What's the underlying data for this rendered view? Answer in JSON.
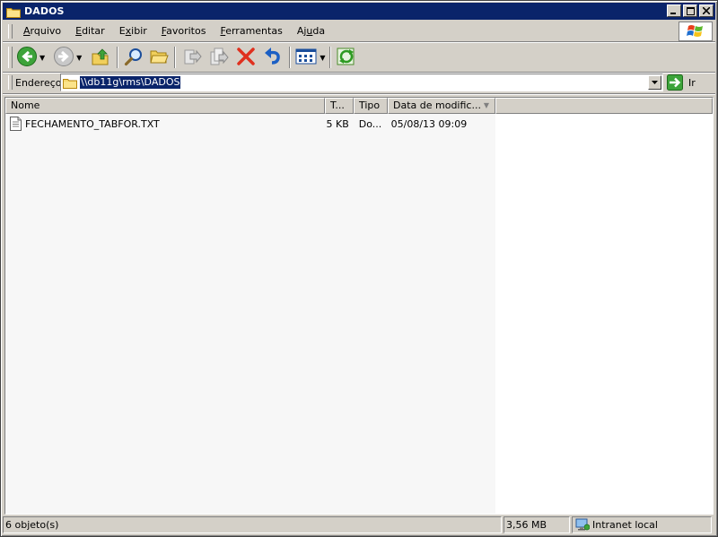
{
  "window": {
    "title": "DADOS",
    "buttons": {
      "minimize": "_",
      "maximize": "□",
      "close": "X"
    }
  },
  "menu": {
    "items": [
      {
        "label": "Arquivo",
        "key": "A"
      },
      {
        "label": "Editar",
        "key": "E"
      },
      {
        "label": "Exibir",
        "key": "x"
      },
      {
        "label": "Favoritos",
        "key": "F"
      },
      {
        "label": "Ferramentas",
        "key": "F"
      },
      {
        "label": "Ajuda",
        "key": "u"
      }
    ]
  },
  "toolbar": {
    "icons": [
      "back-icon",
      "forward-icon",
      "up-folder-icon",
      "search-icon",
      "folders-icon",
      "move-to-icon",
      "copy-to-icon",
      "delete-icon",
      "undo-icon",
      "views-icon",
      "sync-icon"
    ]
  },
  "address": {
    "label": "Endereço",
    "value": "\\\\db11g\\rms\\DADOS",
    "go_label": "Ir"
  },
  "list": {
    "columns": [
      "Nome",
      "T...",
      "Tipo",
      "Data de modific..."
    ],
    "rows": [
      {
        "name": "FECHAMENTO_TABFOR.TXT",
        "size": "5 KB",
        "type": "Do...",
        "modified": "05/08/13 09:09"
      }
    ]
  },
  "status": {
    "objects": "6 objeto(s)",
    "size": "3,56 MB",
    "zone": "Intranet local"
  },
  "colors": {
    "titlebar": "#0a246a",
    "face": "#d4d0c8",
    "selection": "#0a246a"
  }
}
